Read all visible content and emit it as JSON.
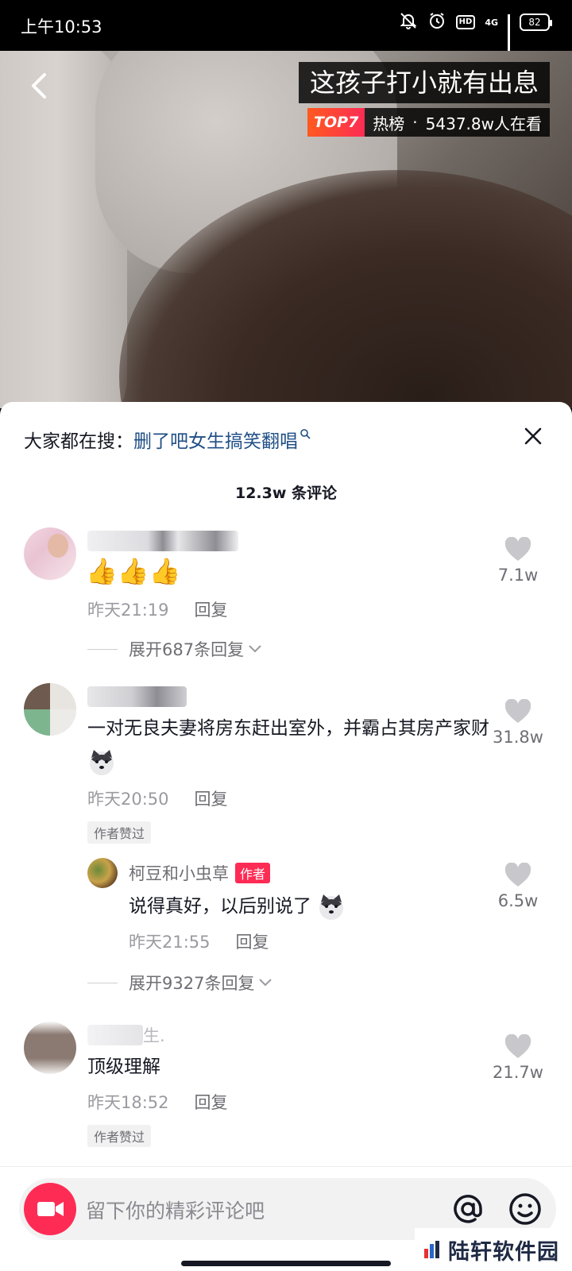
{
  "status_bar": {
    "time": "上午10:53",
    "network": "4G",
    "battery": "82",
    "hd": "HD"
  },
  "video": {
    "title": "这孩子打小就有出息",
    "rank_badge": "TOP7",
    "hot_label": "热榜",
    "separator": "·",
    "viewers": "5437.8w人在看"
  },
  "search_suggest": {
    "prefix": "大家都在搜：",
    "term": "删了吧女生搞笑翻唱"
  },
  "comments_header": {
    "count": "12.3w 条评论"
  },
  "comments": [
    {
      "text": "👍👍👍",
      "time": "昨天21:19",
      "reply_label": "回复",
      "likes": "7.1w",
      "expand": "展开687条回复"
    },
    {
      "text": "一对无良夫妻将房东赶出室外，并霸占其房产家财",
      "time": "昨天20:50",
      "reply_label": "回复",
      "likes": "31.8w",
      "author_liked": "作者赞过",
      "reply": {
        "name": "柯豆和小虫草",
        "tag": "作者",
        "text": "说得真好，以后别说了",
        "time": "昨天21:55",
        "reply_label": "回复",
        "likes": "6.5w"
      },
      "expand": "展开9327条回复"
    },
    {
      "name_fragment": "生.",
      "text": "顶级理解",
      "time": "昨天18:52",
      "reply_label": "回复",
      "likes": "21.7w",
      "author_liked": "作者赞过"
    }
  ],
  "input_bar": {
    "placeholder": "留下你的精彩评论吧"
  },
  "watermark": {
    "text": "陆轩软件园"
  },
  "colors": {
    "accent": "#fe2c55",
    "link": "#1f4f86",
    "meta": "#9a9aa0"
  }
}
